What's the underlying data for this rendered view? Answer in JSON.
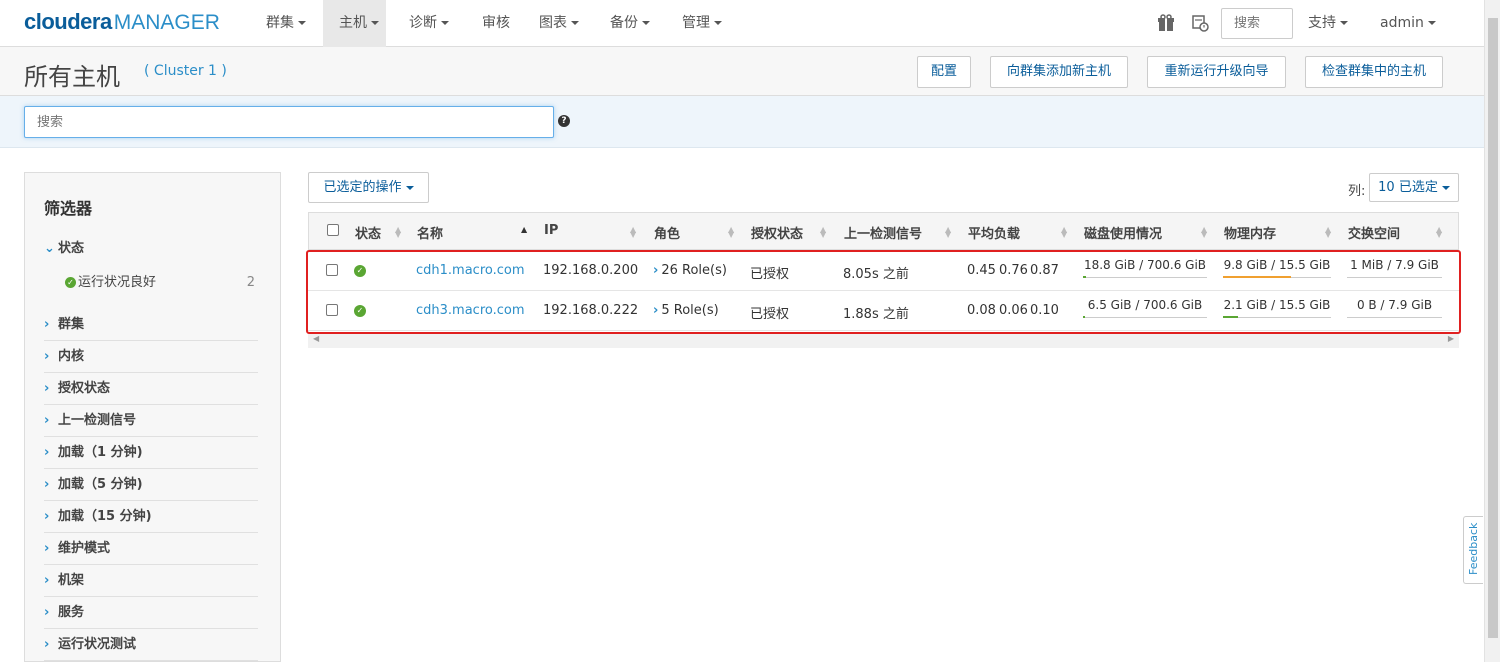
{
  "brand": {
    "name": "cloudera",
    "product": "MANAGER"
  },
  "nav": {
    "items": [
      {
        "label": "群集",
        "dropdown": true
      },
      {
        "label": "主机",
        "dropdown": true,
        "active": true
      },
      {
        "label": "诊断",
        "dropdown": true
      },
      {
        "label": "审核",
        "dropdown": false
      },
      {
        "label": "图表",
        "dropdown": true
      },
      {
        "label": "备份",
        "dropdown": true
      },
      {
        "label": "管理",
        "dropdown": true
      }
    ],
    "search_placeholder": "搜索",
    "support": "支持",
    "user": "admin",
    "icons": [
      "gift-icon",
      "scheduler-icon"
    ]
  },
  "page": {
    "title": "所有主机",
    "cluster": "( Cluster 1 )",
    "buttons": [
      "配置",
      "向群集添加新主机",
      "重新运行升级向导",
      "检查群集中的主机"
    ],
    "search_placeholder": "搜索"
  },
  "filters": {
    "title": "筛选器",
    "expanded_group": "状态",
    "status_item": {
      "label": "运行状况良好",
      "count": "2"
    },
    "groups": [
      "群集",
      "内核",
      "授权状态",
      "上一检测信号",
      "加载（1 分钟)",
      "加载（5 分钟)",
      "加载（15 分钟)",
      "维护模式",
      "机架",
      "服务",
      "运行状况测试"
    ]
  },
  "toolbar": {
    "selected_actions": "已选定的操作",
    "columns_label": "列:",
    "columns_value": "10 已选定"
  },
  "table": {
    "headers": [
      "状态",
      "名称",
      "IP",
      "角色",
      "授权状态",
      "上一检测信号",
      "平均负载",
      "磁盘使用情况",
      "物理内存",
      "交换空间"
    ],
    "rows": [
      {
        "name": "cdh1.macro.com",
        "ip": "192.168.0.200",
        "roles": "26 Role(s)",
        "auth": "已授权",
        "heartbeat": "8.05s 之前",
        "load": [
          "0.45",
          "0.76",
          "0.87"
        ],
        "disk": "18.8 GiB / 700.6 GiB",
        "disk_pct": 2.7,
        "mem": "9.8 GiB / 15.5 GiB",
        "mem_pct": 63,
        "swap": "1 MiB / 7.9 GiB",
        "swap_pct": 0
      },
      {
        "name": "cdh3.macro.com",
        "ip": "192.168.0.222",
        "roles": "5 Role(s)",
        "auth": "已授权",
        "heartbeat": "1.88s 之前",
        "load": [
          "0.08",
          "0.06",
          "0.10"
        ],
        "disk": "6.5 GiB / 700.6 GiB",
        "disk_pct": 0.9,
        "mem": "2.1 GiB / 15.5 GiB",
        "mem_pct": 13.5,
        "swap": "0 B / 7.9 GiB",
        "swap_pct": 0
      }
    ]
  },
  "colors": {
    "mem_high": "#f0a030",
    "mem_low": "#5aa633",
    "disk": "#5aa633",
    "highlight": "#e02020"
  },
  "feedback": "Feedback"
}
